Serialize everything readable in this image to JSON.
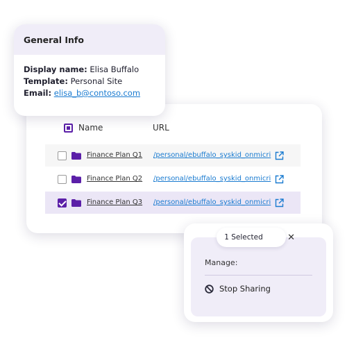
{
  "general_info": {
    "title": "General Info",
    "display_name_label": "Display name:",
    "display_name": "Elisa Buffalo",
    "template_label": "Template:",
    "template": "Personal Site",
    "email_label": "Email:",
    "email": "elisa_b@contoso.com"
  },
  "files_table": {
    "columns": {
      "name": "Name",
      "url": "URL"
    },
    "header_checkbox": "partial",
    "rows": [
      {
        "name": "Finance Plan Q1",
        "url": "/personal/ebuffalo_syskid_onmicri",
        "checked": false
      },
      {
        "name": "Finance Plan Q2",
        "url": "/personal/ebuffalo_syskid_onmicri",
        "checked": false
      },
      {
        "name": "Finance Plan Q3",
        "url": "/personal/ebuffalo_syskid_onmicri",
        "checked": true
      }
    ]
  },
  "selection_panel": {
    "selected_label": "1 Selected",
    "close_label": "✕",
    "manage_label": "Manage:",
    "action_label": "Stop Sharing"
  },
  "icons": {
    "folder": "folder-icon",
    "external_link": "external-link-icon",
    "stop": "stop-icon",
    "close": "close-icon"
  },
  "colors": {
    "accent": "#5b1fa8",
    "link": "#1a7bd0",
    "selected_row": "#ebe6f6",
    "panel_bg": "#f0edf8"
  }
}
